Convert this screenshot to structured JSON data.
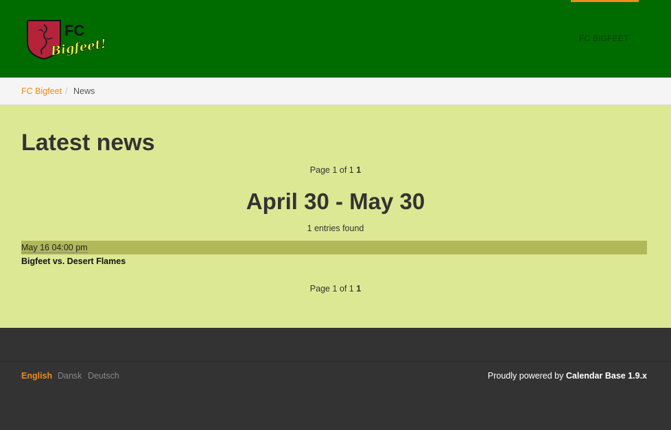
{
  "header": {
    "logo_text_top": "FC",
    "logo_text_bottom": "Bigfeet!",
    "nav_link": "FC BIGFEET",
    "colors": {
      "header_bg": "#006c00",
      "accent": "#f08a1a"
    }
  },
  "breadcrumb": {
    "home": "FC Bigfeet",
    "separator": "/",
    "current": "News"
  },
  "main": {
    "title": "Latest news",
    "pager": {
      "prefix": "Page 1 of 1",
      "current": "1"
    },
    "range_title": "April 30 - May 30",
    "entries_count": "1",
    "entries_label": "entries found",
    "events": [
      {
        "date": "May 16 04:00 pm",
        "title": "Bigfeet vs. Desert Flames"
      }
    ],
    "colors": {
      "main_bg": "#dde894",
      "event_bar": "#b0b85a"
    }
  },
  "footer": {
    "languages": [
      "English",
      "Dansk",
      "Deutsch"
    ],
    "powered_prefix": "Proudly powered by",
    "powered_brand": "Calendar Base 1.9.x"
  }
}
